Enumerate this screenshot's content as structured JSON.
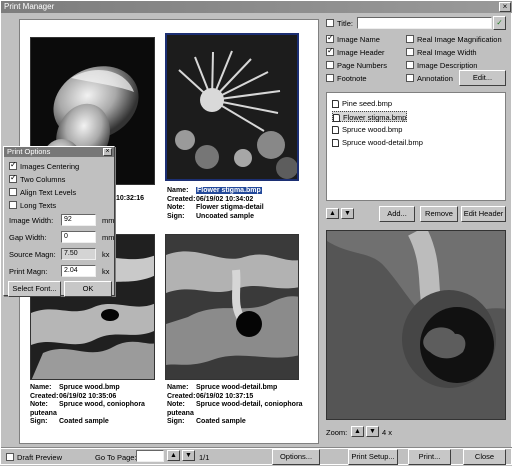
{
  "window": {
    "title": "Print Manager"
  },
  "images": [
    {
      "name": "Pine seed.bmp",
      "created": "06/19/02",
      "time": "10:32:16"
    },
    {
      "name": "Flower stigma.bmp",
      "created": "06/19/02",
      "time": "10:34:02",
      "note": "Flower stigma-detail",
      "sign": "Uncoated sample"
    },
    {
      "name": "Spruce wood.bmp",
      "created": "06/19/02",
      "time": "10:35:06",
      "note": "Spruce wood, coniophora puteana",
      "sign": "Coated sample"
    },
    {
      "name": "Spruce wood-detail.bmp",
      "created": "06/19/02",
      "time": "10:37:15",
      "note": "Spruce wood-detail, coniophora puteana",
      "sign": "Coated sample"
    }
  ],
  "caption_labels": {
    "name": "Name:",
    "created": "Created:",
    "note": "Note:",
    "sign": "Sign:"
  },
  "print_options": {
    "title": "Print Options",
    "checkboxes": [
      {
        "label": "Images Centering",
        "checked": true
      },
      {
        "label": "Two Columns",
        "checked": true
      },
      {
        "label": "Align Text Levels",
        "checked": false
      },
      {
        "label": "Long Texts",
        "checked": false
      }
    ],
    "fields": [
      {
        "label": "Image Width:",
        "value": "92",
        "unit": "mm"
      },
      {
        "label": "Gap Width:",
        "value": "0",
        "unit": "mm"
      },
      {
        "label": "Source Magn:",
        "value": "7.50",
        "unit": "kx"
      },
      {
        "label": "Print Magn:",
        "value": "2.04",
        "unit": "kx"
      }
    ],
    "select_font": "Select Font...",
    "ok": "OK"
  },
  "header_options": {
    "title_label": "Title:",
    "left": [
      {
        "label": "Image Name",
        "checked": true
      },
      {
        "label": "Image Header",
        "checked": true
      },
      {
        "label": "Page Numbers",
        "checked": false
      },
      {
        "label": "Footnote",
        "checked": false
      }
    ],
    "right": [
      {
        "label": "Real Image Magnification",
        "checked": false
      },
      {
        "label": "Real Image Width",
        "checked": false
      },
      {
        "label": "Image Description",
        "checked": false
      },
      {
        "label": "Annotation",
        "checked": false
      }
    ],
    "edit": "Edit..."
  },
  "file_list": [
    "Pine seed.bmp",
    "Flower stigma.bmp",
    "Spruce wood.bmp",
    "Spruce wood-detail.bmp"
  ],
  "list_buttons": {
    "add": "Add...",
    "remove": "Remove",
    "edit_header": "Edit Header"
  },
  "zoom": {
    "label": "Zoom:",
    "value": "4 x"
  },
  "bottom_bar": {
    "draft_preview": "Draft Preview",
    "go_to_page": "Go To Page:",
    "page_value": "",
    "page_count": "1/1",
    "options": "Options...",
    "print_setup": "Print Setup...",
    "print": "Print...",
    "close": "Close"
  },
  "colors": {
    "selection": "#244a9b",
    "window": "#c0c0c0"
  }
}
